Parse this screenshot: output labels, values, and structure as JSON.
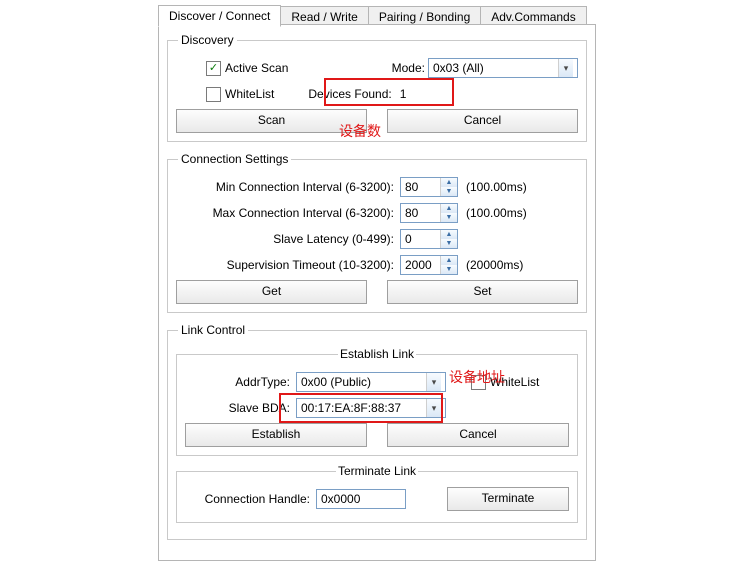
{
  "tabs": [
    "Discover / Connect",
    "Read / Write",
    "Pairing / Bonding",
    "Adv.Commands"
  ],
  "discovery": {
    "legend": "Discovery",
    "active_scan_label": "Active Scan",
    "whitelist_label": "WhiteList",
    "mode_label": "Mode:",
    "mode_value": "0x03 (All)",
    "devices_found_label": "Devices Found:",
    "devices_found_value": "1",
    "scan_btn": "Scan",
    "cancel_btn": "Cancel"
  },
  "annotations": {
    "device_count": "设备数",
    "device_address": "设备地址"
  },
  "conn": {
    "legend": "Connection Settings",
    "min_label": "Min Connection Interval (6-3200):",
    "min_value": "80",
    "min_hint": "(100.00ms)",
    "max_label": "Max Connection Interval (6-3200):",
    "max_value": "80",
    "max_hint": "(100.00ms)",
    "lat_label": "Slave Latency (0-499):",
    "lat_value": "0",
    "sup_label": "Supervision Timeout (10-3200):",
    "sup_value": "2000",
    "sup_hint": "(20000ms)",
    "get_btn": "Get",
    "set_btn": "Set"
  },
  "link": {
    "legend": "Link Control",
    "est_legend": "Establish Link",
    "addr_type_label": "AddrType:",
    "addr_type_value": "0x00 (Public)",
    "whitelist_label": "WhiteList",
    "slave_bda_label": "Slave BDA:",
    "slave_bda_value": "00:17:EA:8F:88:37",
    "establish_btn": "Establish",
    "cancel_btn": "Cancel",
    "term_legend": "Terminate Link",
    "conn_handle_label": "Connection Handle:",
    "conn_handle_value": "0x0000",
    "terminate_btn": "Terminate"
  }
}
